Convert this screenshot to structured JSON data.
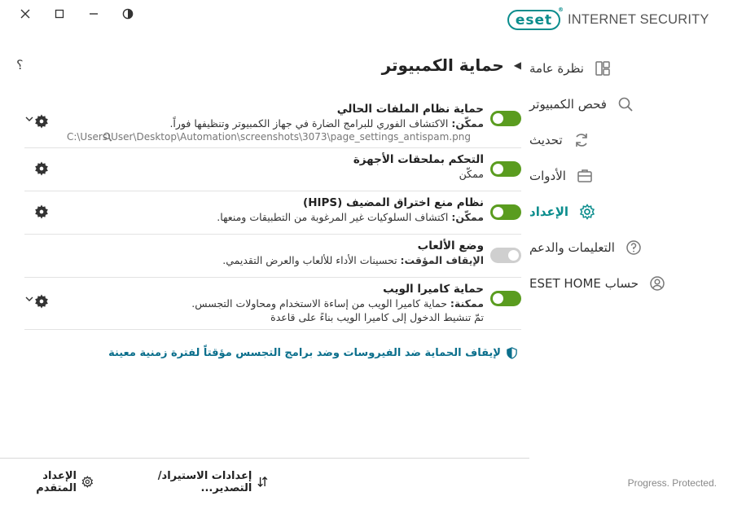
{
  "brand": {
    "logo": "eset",
    "product": "INTERNET SECURITY"
  },
  "sidebar": {
    "items": [
      {
        "label": "نظرة عامة",
        "icon": "overview-icon"
      },
      {
        "label": "فحص الكمبيوتر",
        "icon": "search-icon"
      },
      {
        "label": "تحديث",
        "icon": "refresh-icon"
      },
      {
        "label": "الأدوات",
        "icon": "briefcase-icon"
      },
      {
        "label": "الإعداد",
        "icon": "gear-icon"
      },
      {
        "label": "التعليمات والدعم",
        "icon": "help-icon"
      },
      {
        "label": "حساب ESET HOME",
        "icon": "account-icon"
      }
    ],
    "active_index": 4
  },
  "header": {
    "title": "حماية الكمبيوتر",
    "help_label": "؟"
  },
  "rows": [
    {
      "title": "حماية نظام الملفات الحالي",
      "desc_strong": "ممكّن:",
      "desc": " الاكتشاف الفوري للبرامج الضارة في جهاز الكمبيوتر وتنظيفها فوراً.",
      "path": "C:\\Users\\User\\Desktop\\Automation\\screenshots\\3073\\page_settings_antispam.png",
      "enabled": true
    },
    {
      "title": "التحكم بملحقات الأجهزة",
      "desc_strong": "",
      "desc": "ممكّن",
      "enabled": true
    },
    {
      "title": "نظام منع اختراق المضيف (HIPS)",
      "desc_strong": "ممكّن:",
      "desc": " اكتشاف السلوكيات غير المرغوبة من التطبيقات ومنعها.",
      "enabled": true
    },
    {
      "title": "وضع الألعاب",
      "desc_strong": "الإيقاف المؤقت:",
      "desc": " تحسينات الأداء للألعاب والعرض التقديمي.",
      "enabled": false
    },
    {
      "title": "حماية كاميرا الويب",
      "desc_strong": "ممكنة:",
      "desc": " حماية كاميرا الويب من إساءة الاستخدام ومحاولات التجسس.",
      "desc2": "تمّ تنشيط الدخول إلى كاميرا الويب بناءً على قاعدة",
      "enabled": true
    }
  ],
  "pause_link": "لإيقاف الحماية ضد الفيروسات وضد برامج التجسس مؤقتاً لفترة زمنية معينة",
  "bottom": {
    "import_export": "إعدادات الاستيراد/التصدير...",
    "advanced": "الإعداد المتقدم"
  },
  "footer_tag": "Progress. Protected.",
  "colors": {
    "accent": "#0b8d8d",
    "toggle_on": "#5a9c1f",
    "toggle_off": "#cfcfcf",
    "link": "#0b6f8c"
  }
}
